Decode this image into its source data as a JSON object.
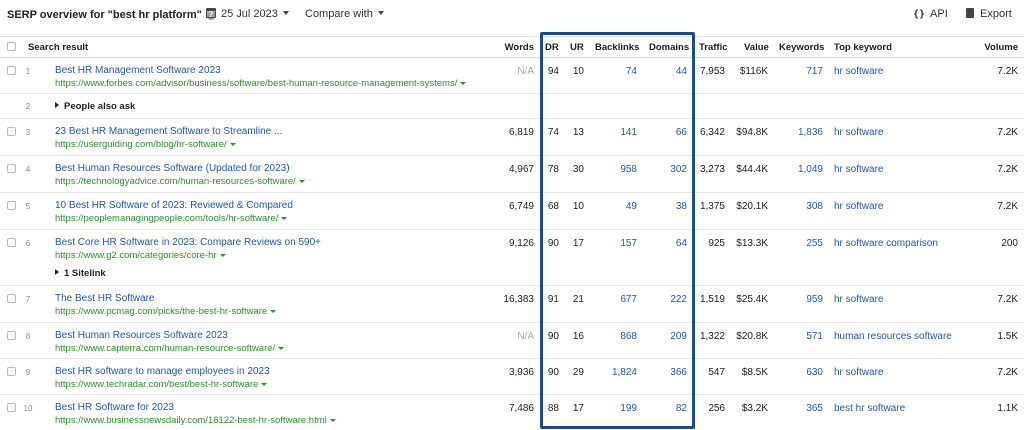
{
  "header": {
    "title": "SERP overview for \"best hr platform\"",
    "date": "25 Jul 2023",
    "compare_label": "Compare with",
    "api_icon": "{}",
    "api_label": "API",
    "export_label": "Export"
  },
  "columns": {
    "search_result": "Search result",
    "words": "Words",
    "dr": "DR",
    "ur": "UR",
    "backlinks": "Backlinks",
    "domains": "Domains",
    "traffic": "Traffic",
    "value": "Value",
    "keywords": "Keywords",
    "top_keyword": "Top keyword",
    "volume": "Volume"
  },
  "rows": [
    {
      "num": "1",
      "title": "Best HR Management Software 2023",
      "url": "https://www.forbes.com/advisor/business/software/best-human-resource-management-systems/",
      "words": "N/A",
      "dr": "94",
      "ur": "10",
      "backlinks": "74",
      "domains": "44",
      "traffic": "7,953",
      "value": "$116K",
      "keywords": "717",
      "top_keyword": "hr software",
      "volume": "7.2K"
    },
    {
      "num": "2",
      "label": "People also ask"
    },
    {
      "num": "3",
      "title": "23 Best HR Management Software to Streamline ...",
      "url": "https://userguiding.com/blog/hr-software/",
      "words": "6,819",
      "dr": "74",
      "ur": "13",
      "backlinks": "141",
      "domains": "66",
      "traffic": "6,342",
      "value": "$94.8K",
      "keywords": "1,836",
      "top_keyword": "hr software",
      "volume": "7.2K"
    },
    {
      "num": "4",
      "title": "Best Human Resources Software (Updated for 2023)",
      "url": "https://technologyadvice.com/human-resources-software/",
      "words": "4,967",
      "dr": "78",
      "ur": "30",
      "backlinks": "958",
      "domains": "302",
      "traffic": "3,273",
      "value": "$44.4K",
      "keywords": "1,049",
      "top_keyword": "hr software",
      "volume": "7.2K"
    },
    {
      "num": "5",
      "title": "10 Best HR Software of 2023: Reviewed & Compared",
      "url": "https://peoplemanagingpeople.com/tools/hr-software/",
      "words": "6,749",
      "dr": "68",
      "ur": "10",
      "backlinks": "49",
      "domains": "38",
      "traffic": "1,375",
      "value": "$20.1K",
      "keywords": "308",
      "top_keyword": "hr software",
      "volume": "7.2K"
    },
    {
      "num": "6",
      "title": "Best Core HR Software in 2023: Compare Reviews on 590+",
      "url": "https://www.g2.com/categories/core-hr",
      "words": "9,126",
      "dr": "90",
      "ur": "17",
      "backlinks": "157",
      "domains": "64",
      "traffic": "925",
      "value": "$13.3K",
      "keywords": "255",
      "top_keyword": "hr software comparison",
      "volume": "200",
      "sitelink": "1 Sitelink"
    },
    {
      "num": "7",
      "title": "The Best HR Software",
      "url": "https://www.pcmag.com/picks/the-best-hr-software",
      "words": "16,383",
      "dr": "91",
      "ur": "21",
      "backlinks": "677",
      "domains": "222",
      "traffic": "1,519",
      "value": "$25.4K",
      "keywords": "959",
      "top_keyword": "hr software",
      "volume": "7.2K"
    },
    {
      "num": "8",
      "title": "Best Human Resources Software 2023",
      "url": "https://www.capterra.com/human-resource-software/",
      "words": "N/A",
      "dr": "90",
      "ur": "16",
      "backlinks": "868",
      "domains": "209",
      "traffic": "1,322",
      "value": "$20.8K",
      "keywords": "571",
      "top_keyword": "human resources software",
      "volume": "1.5K"
    },
    {
      "num": "9",
      "title": "Best HR software to manage employees in 2023",
      "url": "https://www.techradar.com/best/best-hr-software",
      "words": "3,936",
      "dr": "90",
      "ur": "29",
      "backlinks": "1,824",
      "domains": "366",
      "traffic": "547",
      "value": "$8.5K",
      "keywords": "630",
      "top_keyword": "hr software",
      "volume": "7.2K"
    },
    {
      "num": "10",
      "title": "Best HR Software for 2023",
      "url": "https://www.businessnewsdaily.com/16122-best-hr-software.html",
      "words": "7,486",
      "dr": "88",
      "ur": "17",
      "backlinks": "199",
      "domains": "82",
      "traffic": "256",
      "value": "$3.2K",
      "keywords": "365",
      "top_keyword": "best hr software",
      "volume": "1.1K"
    }
  ]
}
